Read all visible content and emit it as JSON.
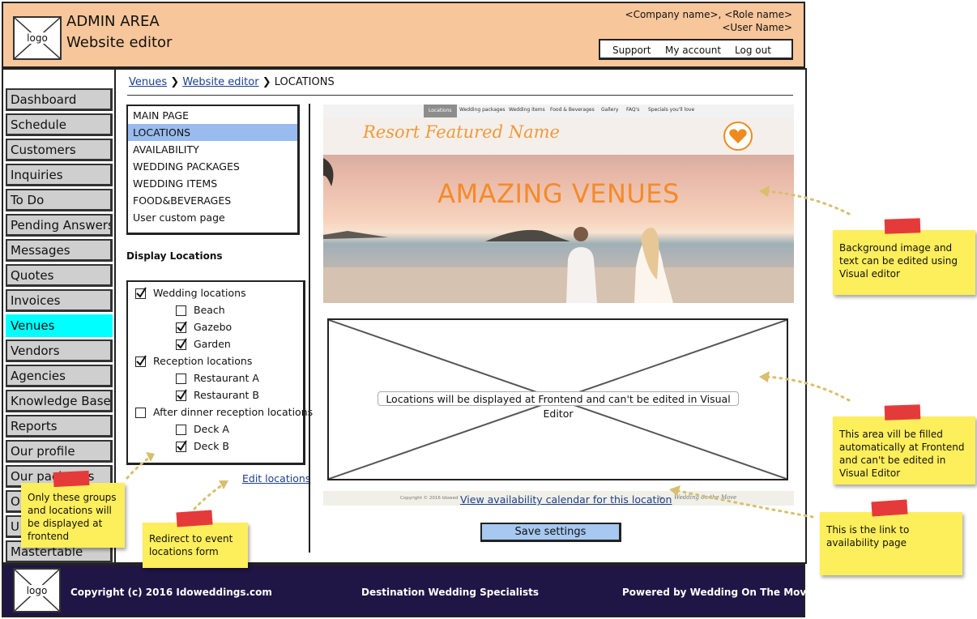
{
  "header": {
    "logo_label": "logo",
    "title": "ADMIN AREA",
    "subtitle": "Website editor",
    "company_role": "<Company name>, <Role name>",
    "user_name": "<User Name>",
    "nav": [
      "Support",
      "My account",
      "Log out"
    ]
  },
  "sidebar": {
    "items": [
      "Dashboard",
      "Schedule",
      "Customers",
      "Inquiries",
      "To Do",
      "Pending Answers",
      "Messages",
      "Quotes",
      "Invoices",
      "Venues",
      "Vendors",
      "Agencies",
      "Knowledge Base",
      "Reports",
      "Our profile",
      "Our packages",
      "O",
      "U",
      "Mastertable"
    ],
    "active": "Venues"
  },
  "breadcrumb": {
    "crumbs": [
      "Venues",
      "Website editor"
    ],
    "current": "LOCATIONS",
    "separator": "❯"
  },
  "page_list": {
    "items": [
      "MAIN PAGE",
      "LOCATIONS",
      "AVAILABILITY",
      "WEDDING PACKAGES",
      "WEDDING ITEMS",
      "FOOD&BEVERAGES",
      "User custom page"
    ],
    "selected": "LOCATIONS"
  },
  "display_locations": {
    "heading": "Display Locations",
    "items": [
      {
        "label": "Wedding locations",
        "checked": true,
        "indent": 0
      },
      {
        "label": "Beach",
        "checked": false,
        "indent": 1
      },
      {
        "label": "Gazebo",
        "checked": true,
        "indent": 1
      },
      {
        "label": "Garden",
        "checked": true,
        "indent": 1
      },
      {
        "label": "Reception locations",
        "checked": true,
        "indent": 0
      },
      {
        "label": "Restaurant A",
        "checked": false,
        "indent": 1
      },
      {
        "label": "Restaurant B",
        "checked": true,
        "indent": 1
      },
      {
        "label": "After dinner reception locations",
        "checked": false,
        "indent": 0
      },
      {
        "label": "Deck A",
        "checked": false,
        "indent": 1
      },
      {
        "label": "Deck B",
        "checked": true,
        "indent": 1
      }
    ],
    "edit_link": "Edit locations"
  },
  "preview": {
    "nav": [
      "Locations",
      "Wedding packages",
      "Wedding items",
      "Food & Beverages",
      "Gallery",
      "FAQ's",
      "Specials you'll love"
    ],
    "resort_name": "Resort Featured Name",
    "headline": "AMAZING VENUES",
    "placeholder_text": "Locations will be displayed at Frontend and can't be edited in Visual Editor",
    "footer_copyright": "Copyright © 2016 Idowed",
    "footer_fragment": "dy",
    "footer_signature": "Wedding on the Move",
    "availability_link": "View availability calendar for this location",
    "save_button": "Save settings"
  },
  "footer": {
    "logo_label": "logo",
    "copyright": "Copyright (c) 2016 Idoweddings.com",
    "tagline": "Destination Wedding Specialists",
    "powered": "Powered by Wedding On The Move"
  },
  "notes": {
    "background": "Background image and text can be edited using Visual editor",
    "auto_area": "This area vill be filled automatically at Frontend and can't be edited in Visual Editor",
    "availability": "This is the link to availability page",
    "groups": "Only these groups and locations will be displayed at frontend",
    "redirect": "Redirect to event locations form"
  },
  "colors": {
    "header_bg": "#f8c69b",
    "active_nav": "#00ffff",
    "selected_page": "#99bbee",
    "footer_bg": "#1f1646",
    "note_bg": "#fdee5c",
    "tape": "#e53a3a",
    "accent_orange": "#f58a2a",
    "save_button": "#a7c8f0"
  }
}
